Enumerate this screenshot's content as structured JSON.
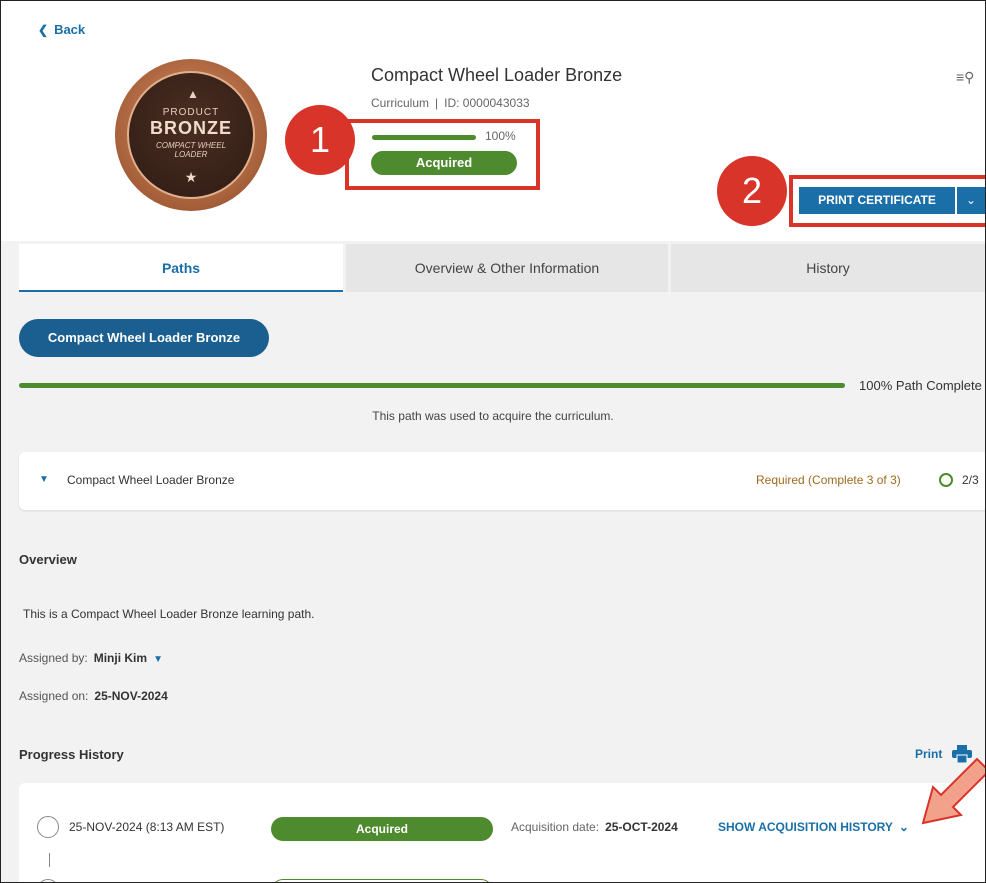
{
  "nav": {
    "back_label": "Back"
  },
  "badge": {
    "line1": "PRODUCT",
    "line2": "BRONZE",
    "line3a": "COMPACT WHEEL",
    "line3b": "LOADER"
  },
  "header": {
    "title": "Compact Wheel Loader Bronze",
    "type": "Curriculum",
    "id_label": "ID: 0000043033",
    "progress_pct": "100%",
    "progress_value": 100,
    "status": "Acquired",
    "print_label": "PRINT CERTIFICATE"
  },
  "callouts": {
    "one": "1",
    "two": "2"
  },
  "tabs": [
    {
      "label": "Paths"
    },
    {
      "label": "Overview & Other Information"
    },
    {
      "label": "History"
    }
  ],
  "path": {
    "pill_label": "Compact Wheel Loader Bronze",
    "complete_label": "100% Path Complete",
    "note": "This path was used to acquire the curriculum."
  },
  "course": {
    "name": "Compact Wheel Loader Bronze",
    "requirement": "Required (Complete 3 of 3)",
    "count": "2/3"
  },
  "overview": {
    "heading": "Overview",
    "description": "This is a Compact Wheel Loader Bronze learning path.",
    "assigned_by_label": "Assigned by:",
    "assigned_by_value": "Minji Kim",
    "assigned_on_label": "Assigned on:",
    "assigned_on_value": "25-NOV-2024"
  },
  "progress_history": {
    "heading": "Progress History",
    "print_label": "Print",
    "rows": [
      {
        "date": "25-NOV-2024 (8:13 AM EST)",
        "status": "Acquired",
        "acq_label": "Acquisition date:",
        "acq_value": "25-OCT-2024",
        "show_label": "SHOW ACQUISITION HISTORY"
      }
    ]
  },
  "colors": {
    "accent": "#1a6fa8",
    "success": "#4e8a2e",
    "callout": "#d9342a"
  }
}
